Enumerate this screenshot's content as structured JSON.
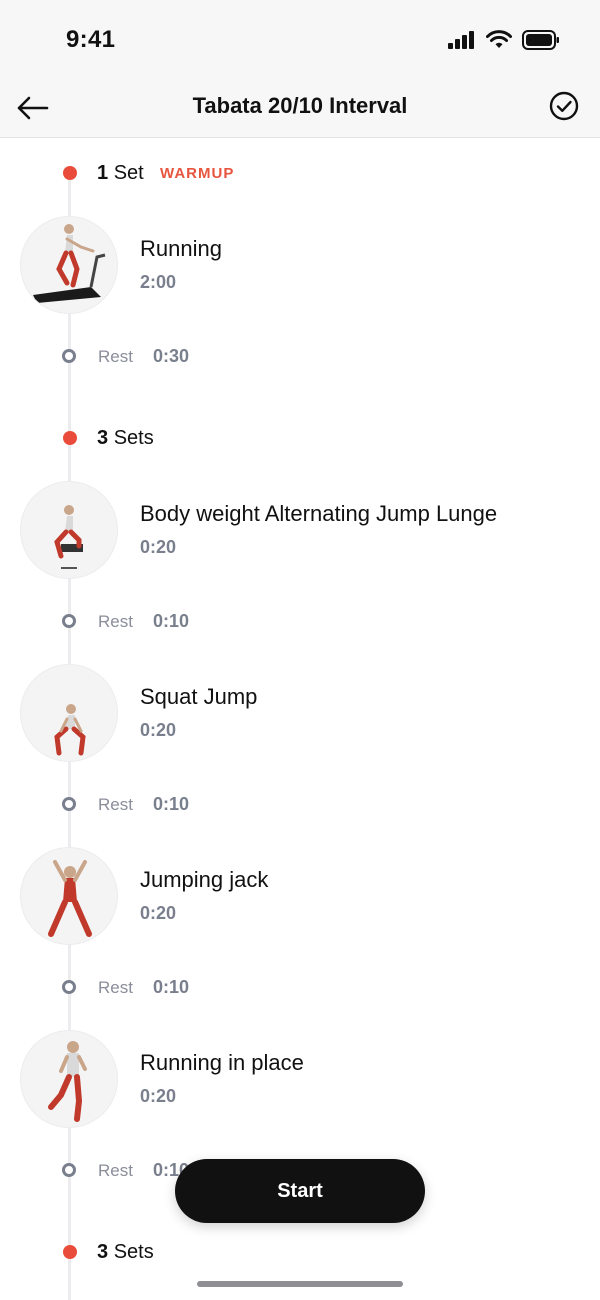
{
  "status_bar": {
    "time": "9:41",
    "icons": [
      "signal-icon",
      "wifi-icon",
      "battery-icon"
    ]
  },
  "nav": {
    "title": "Tabata 20/10 Interval",
    "back_icon": "arrow-left-icon",
    "done_icon": "check-circle-icon"
  },
  "sets": [
    {
      "count": "1",
      "unit": "Set",
      "tag": "WARMUP",
      "items": [
        {
          "name": "Running",
          "duration": "2:00",
          "rest_label": "Rest",
          "rest": "0:30"
        }
      ]
    },
    {
      "count": "3",
      "unit": "Sets",
      "tag": "",
      "items": [
        {
          "name": "Body weight Alternating Jump Lunge",
          "duration": "0:20",
          "rest_label": "Rest",
          "rest": "0:10"
        },
        {
          "name": "Squat Jump",
          "duration": "0:20",
          "rest_label": "Rest",
          "rest": "0:10"
        },
        {
          "name": "Jumping jack",
          "duration": "0:20",
          "rest_label": "Rest",
          "rest": "0:10"
        },
        {
          "name": "Running in place",
          "duration": "0:20",
          "rest_label": "Rest",
          "rest": "0:10"
        }
      ]
    },
    {
      "count": "3",
      "unit": "Sets",
      "tag": "",
      "items": []
    }
  ],
  "actions": {
    "start_label": "Start"
  },
  "colors": {
    "accent": "#ea4c3c",
    "muted": "#7a7f8e",
    "button": "#111111"
  }
}
